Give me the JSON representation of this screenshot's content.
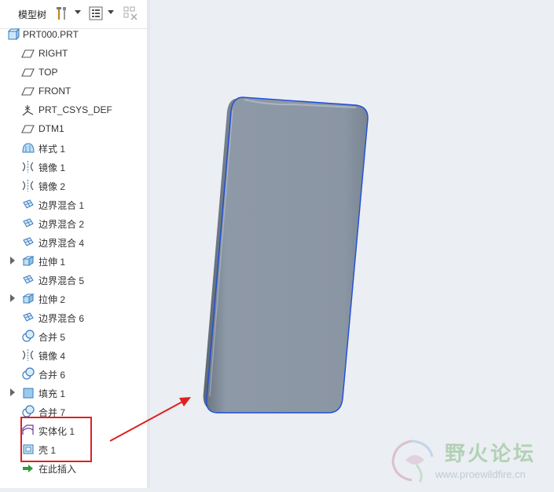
{
  "panel": {
    "title": "模型树"
  },
  "tree": {
    "items": [
      {
        "label": "PRT000.PRT",
        "icon": "part-icon",
        "expandable": false,
        "root": true
      },
      {
        "label": "RIGHT",
        "icon": "datum-plane-icon",
        "expandable": false
      },
      {
        "label": "TOP",
        "icon": "datum-plane-icon",
        "expandable": false
      },
      {
        "label": "FRONT",
        "icon": "datum-plane-icon",
        "expandable": false
      },
      {
        "label": "PRT_CSYS_DEF",
        "icon": "csys-icon",
        "expandable": false
      },
      {
        "label": "DTM1",
        "icon": "datum-plane-icon",
        "expandable": false
      },
      {
        "label": "样式 1",
        "icon": "style-icon",
        "expandable": false
      },
      {
        "label": "镜像 1",
        "icon": "mirror-icon",
        "expandable": false
      },
      {
        "label": "镜像 2",
        "icon": "mirror-icon",
        "expandable": false
      },
      {
        "label": "边界混合 1",
        "icon": "boundary-blend-icon",
        "expandable": false
      },
      {
        "label": "边界混合 2",
        "icon": "boundary-blend-icon",
        "expandable": false
      },
      {
        "label": "边界混合 4",
        "icon": "boundary-blend-icon",
        "expandable": false
      },
      {
        "label": "拉伸 1",
        "icon": "extrude-icon",
        "expandable": true
      },
      {
        "label": "边界混合 5",
        "icon": "boundary-blend-icon",
        "expandable": false
      },
      {
        "label": "拉伸 2",
        "icon": "extrude-icon",
        "expandable": true
      },
      {
        "label": "边界混合 6",
        "icon": "boundary-blend-icon",
        "expandable": false
      },
      {
        "label": "合并 5",
        "icon": "merge-icon",
        "expandable": false
      },
      {
        "label": "镜像 4",
        "icon": "mirror-icon",
        "expandable": false
      },
      {
        "label": "合并 6",
        "icon": "merge-icon",
        "expandable": false
      },
      {
        "label": "填充 1",
        "icon": "fill-icon",
        "expandable": true
      },
      {
        "label": "合并 7",
        "icon": "merge-icon",
        "expandable": false
      },
      {
        "label": "实体化 1",
        "icon": "solidify-icon",
        "expandable": false
      },
      {
        "label": "壳 1",
        "icon": "shell-icon",
        "expandable": false
      },
      {
        "label": "在此插入",
        "icon": "insert-here-icon",
        "expandable": false
      }
    ]
  },
  "watermark": {
    "title": "野火论坛",
    "url": "www.proewildfire.cn"
  },
  "colors": {
    "model_fill": "#8d98a6",
    "model_edge": "#1d4ed8",
    "annotation_red": "#e02020"
  }
}
